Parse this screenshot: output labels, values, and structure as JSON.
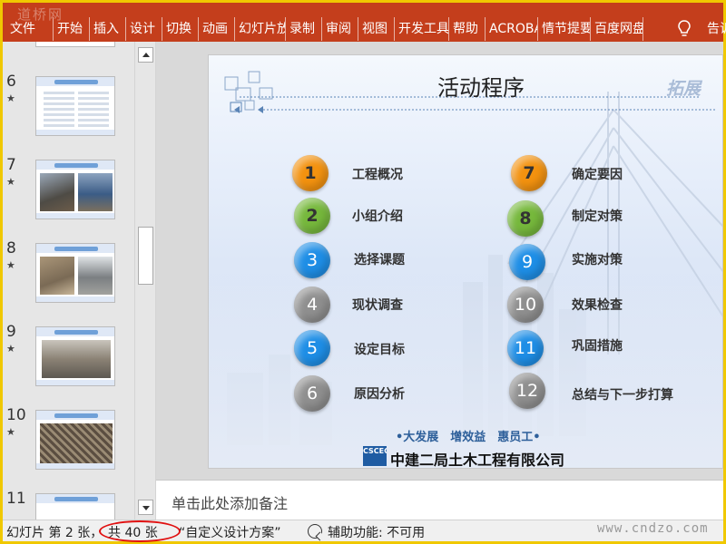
{
  "ribbon": {
    "watermark": "道桥网",
    "tabs": [
      "文件",
      "开始",
      "插入",
      "设计",
      "切换",
      "动画",
      "幻灯片放映",
      "录制",
      "审阅",
      "视图",
      "开发工具",
      "帮助",
      "ACROBAT",
      "情节提要",
      "百度网盘"
    ],
    "tell_me": "告诉我"
  },
  "thumbnails": [
    {
      "number": "6",
      "marker": "★"
    },
    {
      "number": "7",
      "marker": "★"
    },
    {
      "number": "8",
      "marker": "★"
    },
    {
      "number": "9",
      "marker": "★"
    },
    {
      "number": "10",
      "marker": "★"
    },
    {
      "number": "11",
      "marker": ""
    }
  ],
  "slide": {
    "title": "活动程序",
    "decorative_text": "拓展",
    "agenda_left": [
      {
        "num": "1",
        "label": "工程概况",
        "color": "orange"
      },
      {
        "num": "2",
        "label": "小组介绍",
        "color": "green"
      },
      {
        "num": "3",
        "label": "选择课题",
        "color": "blue"
      },
      {
        "num": "4",
        "label": "现状调查",
        "color": "gray"
      },
      {
        "num": "5",
        "label": "设定目标",
        "color": "blue"
      },
      {
        "num": "6",
        "label": "原因分析",
        "color": "gray"
      }
    ],
    "agenda_right": [
      {
        "num": "7",
        "label": "确定要因",
        "color": "orange"
      },
      {
        "num": "8",
        "label": "制定对策",
        "color": "green"
      },
      {
        "num": "9",
        "label": "实施对策",
        "color": "blue"
      },
      {
        "num": "10",
        "label": "效果检查",
        "color": "gray"
      },
      {
        "num": "11",
        "label": "巩固措施",
        "color": "blue"
      },
      {
        "num": "12",
        "label": "总结与下一步打算",
        "color": "gray"
      }
    ],
    "slogan": "•大发展　增效益　惠员工•",
    "company_logo_text": "CSCEC",
    "company_name": "中建二局土木工程有限公司"
  },
  "notes": {
    "placeholder": "单击此处添加备注"
  },
  "status": {
    "slide_pos": "幻灯片 第 2 张，",
    "slide_total": "共 40 张",
    "theme": "“自定义设计方案”",
    "accessibility": "辅助功能: 不可用",
    "site_watermark": "www.cndzo.com"
  },
  "colors": {
    "ribbon": "#c43e1c",
    "frame": "#f0c800",
    "orange": "#f3920f",
    "green": "#76b83c",
    "blue": "#1e8ee6",
    "gray": "#8f8f8f",
    "highlight": "#e01010"
  }
}
